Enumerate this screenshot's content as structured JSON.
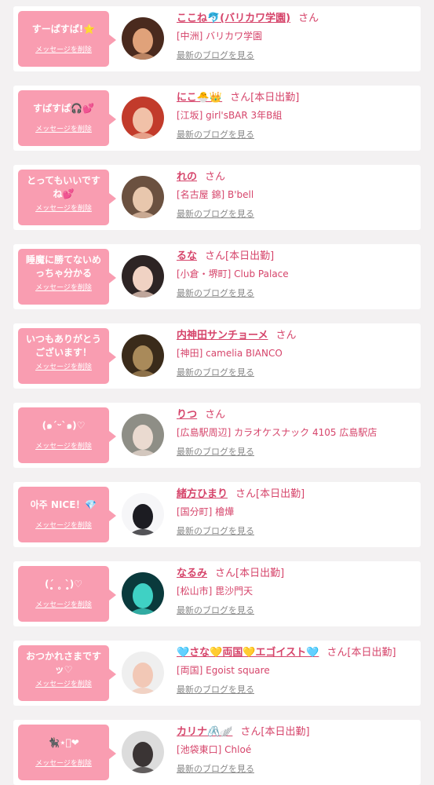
{
  "colors": {
    "accent_pink": "#f99db1",
    "name_pink": "#d6456b",
    "link_gray": "#888888",
    "background": "#f3f1f2"
  },
  "delete_label": "メッセージを削除",
  "blog_label": "最新のブログを見る",
  "items": [
    {
      "message": "すーぱすぱ!⭐",
      "name": "ここね🐬(バリカワ学園)",
      "honorific": "さん",
      "status": "",
      "shop": "[中洲] バリカワ学園",
      "avatar_colors": [
        "#4a2a1e",
        "#e0a27a"
      ]
    },
    {
      "message": "すぱすぱ🎧💕",
      "name": "にこ🐣👑",
      "honorific": "さん",
      "status": "[本日出勤]",
      "shop": "[江坂] girl'sBAR 3年B組",
      "avatar_colors": [
        "#c23b2b",
        "#f1c1a8"
      ]
    },
    {
      "message": "とってもいいですね💕",
      "name": "れの",
      "honorific": "さん",
      "status": "",
      "shop": "[名古屋 錦] B'bell",
      "avatar_colors": [
        "#6b5140",
        "#e8c7ad"
      ]
    },
    {
      "message": "睡魔に勝てないめっちゃ分かる",
      "name": "るな",
      "honorific": "さん",
      "status": "[本日出勤]",
      "shop": "[小倉・堺町] Club Palace",
      "avatar_colors": [
        "#2d2424",
        "#f0d2c3"
      ]
    },
    {
      "message": "いつもありがとうございます！",
      "name": "内神田サンチョーメ",
      "honorific": "さん",
      "status": "",
      "shop": "[神田] camelia BIANCO",
      "avatar_colors": [
        "#3a2b1a",
        "#a98a5a"
      ]
    },
    {
      "message": "(๑ˊᵕˋ๑)♡",
      "name": "りつ",
      "honorific": "さん",
      "status": "",
      "shop": "[広島駅周辺] カラオケスナック 4105 広島駅店",
      "avatar_colors": [
        "#8e8e86",
        "#eadad0"
      ]
    },
    {
      "message": "아주 NICE！💎",
      "name": "緒方ひまり",
      "honorific": "さん",
      "status": "[本日出勤]",
      "shop": "[国分町] 檜燁",
      "avatar_colors": [
        "#f6f6f8",
        "#1c1c22"
      ]
    },
    {
      "message": "(ˊ̥̥̥̥̥ ˳ ˋ̥̥̥̥̥)♡",
      "name": "なるみ",
      "honorific": "さん",
      "status": "[本日出勤]",
      "shop": "[松山市] 毘沙門天",
      "avatar_colors": [
        "#0a3a3c",
        "#3fd1c4"
      ]
    },
    {
      "message": "おつかれさまですッ♡",
      "name": "🩵さな💛両国💛エゴイスト🩵",
      "honorific": "さん",
      "status": "[本日出勤]",
      "shop": "[両国] Egoist square",
      "avatar_colors": [
        "#efefef",
        "#f2c8b6"
      ]
    },
    {
      "message": "🐈‍⬛⋆͛❤︎",
      "name": "カリナ🖇️🪽",
      "honorific": "さん",
      "status": "[本日出勤]",
      "shop": "[池袋東口] Chloé",
      "avatar_colors": [
        "#dcdcdc",
        "#3a3434"
      ]
    }
  ]
}
